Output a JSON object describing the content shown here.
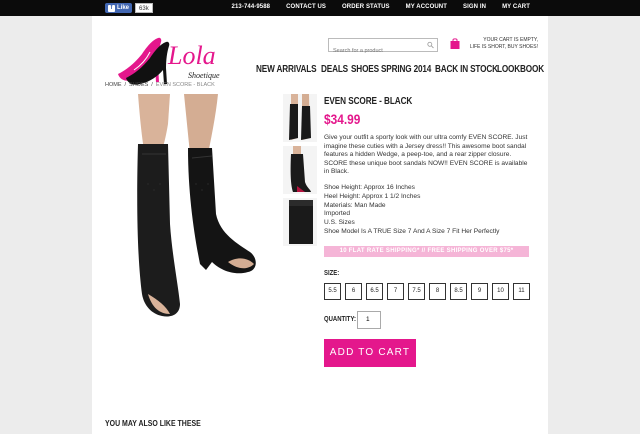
{
  "topbar": {
    "fb_like_label": "Like",
    "fb_count": "63k",
    "nav": [
      "213-744-9588",
      "CONTACT US",
      "ORDER STATUS",
      "MY ACCOUNT",
      "SIGN IN",
      "MY CART"
    ]
  },
  "header": {
    "logo_text": "Lola",
    "logo_sub": "Shoetique",
    "search_placeholder": "Search for a product",
    "cart_line1": "YOUR CART IS EMPTY,",
    "cart_line2": "LIFE IS SHORT, BUY SHOES!"
  },
  "mainnav": [
    "NEW ARRIVALS",
    "DEALS",
    "SHOES",
    "SPRING 2014",
    "BACK IN STOCK",
    "LOOKBOOK"
  ],
  "breadcrumb": [
    "HOME",
    "/",
    "SHOES",
    "/",
    "EVEN SCORE - BLACK"
  ],
  "product": {
    "title": "EVEN SCORE - BLACK",
    "price": "$34.99",
    "description": "Give your outfit a sporty look with our ultra comfy EVEN SCORE. Just imagine these cuties with a Jersey dress!! This awesome boot sandal features a hidden Wedge, a peep-toe, and a rear zipper closure. SCORE these unique boot sandals NOW!! EVEN SCORE is available in Black.",
    "specs": [
      "Shoe Height: Approx 16 Inches",
      "Heel Height: Approx 1 1/2 Inches",
      "Materials: Man Made",
      "Imported",
      "U.S. Sizes",
      "Shoe Model Is A TRUE Size 7 And A Size 7 Fit Her Perfectly"
    ],
    "promo": "10 FLAT RATE SHIPPING*   //   FREE SHIPPING OVER $75*",
    "size_label": "SIZE:",
    "sizes": [
      "5.5",
      "6",
      "6.5",
      "7",
      "7.5",
      "8",
      "8.5",
      "9",
      "10",
      "11"
    ],
    "quantity_label": "QUANTITY:",
    "quantity_value": "1",
    "add_to_cart": "ADD TO CART"
  },
  "also_like": "YOU MAY ALSO LIKE THESE",
  "colors": {
    "accent": "#e4178c",
    "promo": "#f5b5d7",
    "topbar": "#0b0b0b"
  }
}
